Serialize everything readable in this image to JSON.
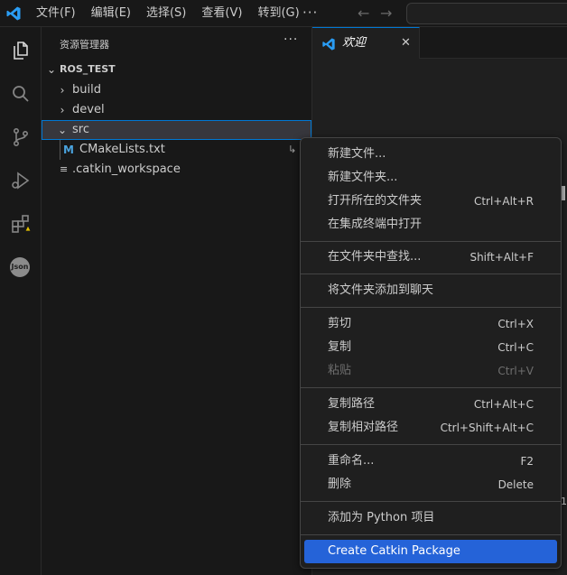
{
  "titlebar": {
    "menu": [
      "文件(F)",
      "编辑(E)",
      "选择(S)",
      "查看(V)",
      "转到(G)"
    ],
    "more": "···",
    "back_arrow": "←",
    "forward_arrow": "→"
  },
  "activity": {
    "items": [
      "explorer-icon",
      "search-icon",
      "source-control-icon",
      "run-debug-icon",
      "extensions-icon",
      "json-icon"
    ],
    "json_label": "Json"
  },
  "sidebar": {
    "title": "资源管理器",
    "more": "···",
    "workspace": "ROS_TEST",
    "items": [
      {
        "label": "build"
      },
      {
        "label": "devel"
      },
      {
        "label": "src"
      },
      {
        "label": "CMakeLists.txt",
        "icon_letter": "M"
      },
      {
        "label": ".catkin_workspace",
        "icon_letter": "≡"
      }
    ],
    "link_arrow": "↳"
  },
  "editor": {
    "tab_label": "欢迎",
    "tab_close": "✕"
  },
  "context_menu": {
    "items": [
      {
        "label": "新建文件...",
        "key": ""
      },
      {
        "label": "新建文件夹...",
        "key": ""
      },
      {
        "label": "打开所在的文件夹",
        "key": "Ctrl+Alt+R"
      },
      {
        "label": "在集成终端中打开",
        "key": ""
      },
      {
        "label": "在文件夹中查找...",
        "key": "Shift+Alt+F"
      },
      {
        "label": "将文件夹添加到聊天",
        "key": ""
      },
      {
        "label": "剪切",
        "key": "Ctrl+X"
      },
      {
        "label": "复制",
        "key": "Ctrl+C"
      },
      {
        "label": "粘贴",
        "key": "Ctrl+V",
        "disabled": true
      },
      {
        "label": "复制路径",
        "key": "Ctrl+Alt+C"
      },
      {
        "label": "复制相对路径",
        "key": "Ctrl+Shift+Alt+C"
      },
      {
        "label": "重命名...",
        "key": "F2"
      },
      {
        "label": "删除",
        "key": "Delete"
      },
      {
        "label": "添加为 Python 项目",
        "key": ""
      },
      {
        "label": "Create Catkin Package",
        "key": "",
        "highlighted": true
      }
    ]
  },
  "edge_digit": "1",
  "colors": {
    "accent": "#0078d4",
    "menu_highlight": "#2563d8",
    "background": "#1f1f1f",
    "sidebar_bg": "#181818"
  }
}
